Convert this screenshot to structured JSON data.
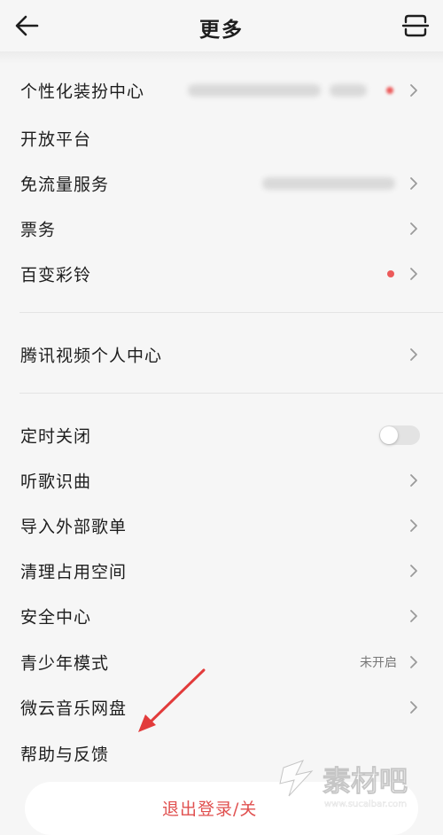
{
  "header": {
    "title": "更多",
    "back_icon": "back-arrow-icon",
    "scan_icon": "scan-icon"
  },
  "section1": [
    {
      "label": "个性化装扮中心",
      "value_blurred": true,
      "red_dot": true,
      "chevron": true
    },
    {
      "label": "开放平台",
      "chevron": false
    },
    {
      "label": "免流量服务",
      "value_blurred": true,
      "chevron": true
    },
    {
      "label": "票务",
      "chevron": true
    },
    {
      "label": "百变彩铃",
      "red_dot": true,
      "chevron": true
    }
  ],
  "section2": [
    {
      "label": "腾讯视频个人中心",
      "chevron": true
    }
  ],
  "section3": {
    "timer": {
      "label": "定时关闭",
      "toggle_on": false
    },
    "items": [
      {
        "label": "听歌识曲"
      },
      {
        "label": "导入外部歌单"
      },
      {
        "label": "清理占用空间"
      },
      {
        "label": "安全中心"
      },
      {
        "label": "青少年模式",
        "value": "未开启"
      },
      {
        "label": "微云音乐网盘"
      },
      {
        "label": "帮助与反馈"
      }
    ]
  },
  "logout": {
    "label": "退出登录/关"
  },
  "watermark": {
    "text": "素材吧",
    "url": "www.sucaibar.com"
  },
  "colors": {
    "accent": "#e0504f",
    "dot": "#ec5a5a",
    "background": "#f6f6f6"
  }
}
